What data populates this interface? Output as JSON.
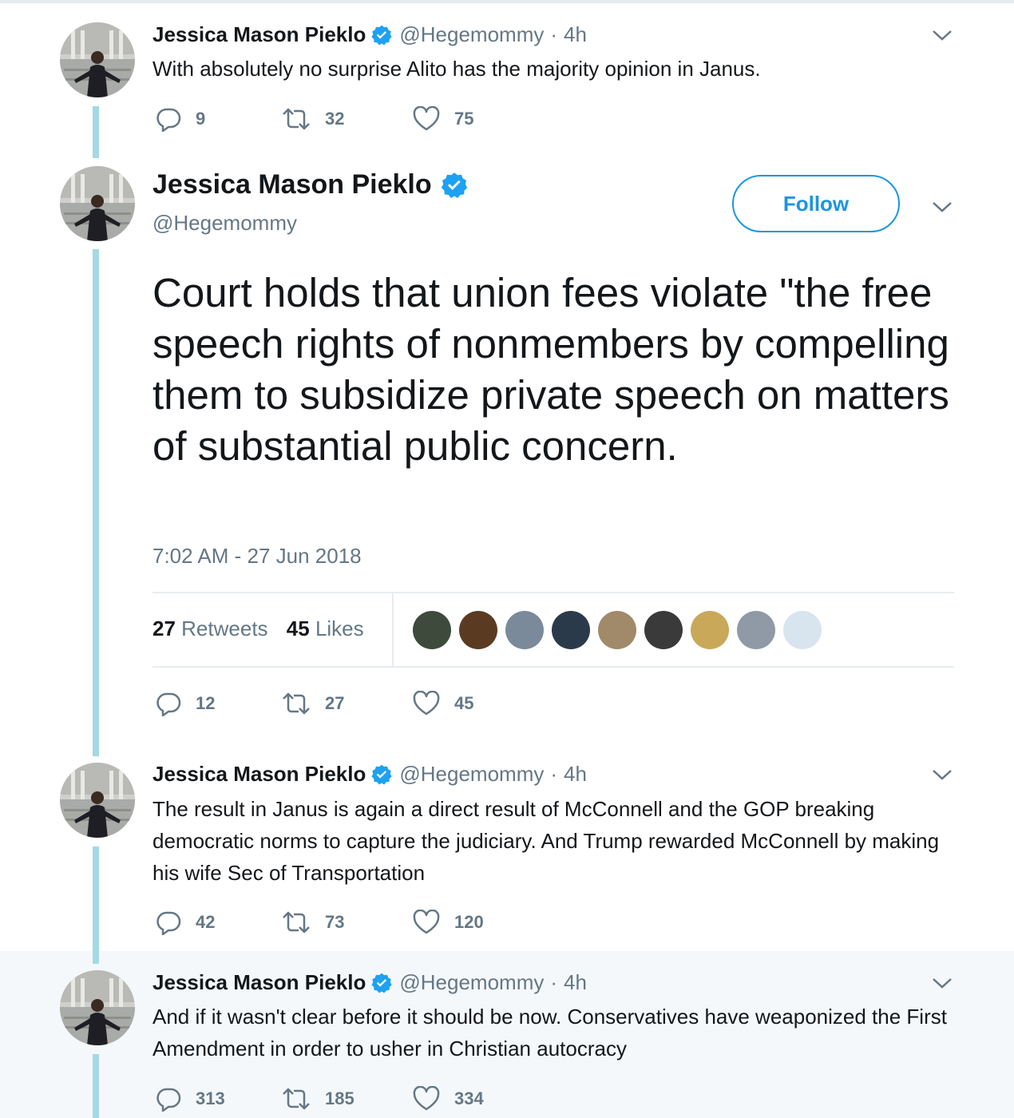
{
  "tweets": [
    {
      "name": "Jessica Mason Pieklo",
      "handle": "@Hegemommy",
      "time": "4h",
      "text": "With absolutely no surprise Alito has the majority opinion in Janus.",
      "replies": "9",
      "retweets": "32",
      "likes": "75"
    },
    {
      "name": "Jessica Mason Pieklo",
      "handle": "@Hegemommy",
      "follow_label": "Follow",
      "text": "Court holds that union fees violate \"the free speech rights of nonmembers by compelling them to subsidize private speech on matters of substantial public concern.",
      "timestamp": "7:02 AM - 27 Jun 2018",
      "retweet_count": "27",
      "retweet_label": "Retweets",
      "like_count": "45",
      "like_label": "Likes",
      "replies": "12",
      "retweets": "27",
      "likes": "45"
    },
    {
      "name": "Jessica Mason Pieklo",
      "handle": "@Hegemommy",
      "time": "4h",
      "text": "The result in Janus is again a direct result of McConnell and the GOP breaking democratic norms to capture the judiciary. And Trump rewarded McConnell by making his wife Sec of Transportation",
      "replies": "42",
      "retweets": "73",
      "likes": "120"
    },
    {
      "name": "Jessica Mason Pieklo",
      "handle": "@Hegemommy",
      "time": "4h",
      "text": "And if it wasn't clear before it should be now. Conservatives have weaponized the First Amendment in order to usher in Christian autocracy",
      "replies": "313",
      "retweets": "185",
      "likes": "334"
    }
  ],
  "separator": "·",
  "colors": {
    "thread_line": "#a4d9e4",
    "verified": "#1da1f2",
    "follow": "#1b95e0",
    "muted": "#657786",
    "text": "#14171a",
    "highlight_bg": "#f5f8fa"
  },
  "icons": [
    "reply-icon",
    "retweet-icon",
    "like-icon",
    "verified-badge-icon",
    "chevron-down-icon"
  ],
  "liker_avatar_colors": [
    "#3d4a3c",
    "#5a3b22",
    "#7a8a9a",
    "#2b3a4a",
    "#a08a6a",
    "#3a3a3a",
    "#c9a85a",
    "#8f9aa6",
    "#d8e4ee"
  ]
}
